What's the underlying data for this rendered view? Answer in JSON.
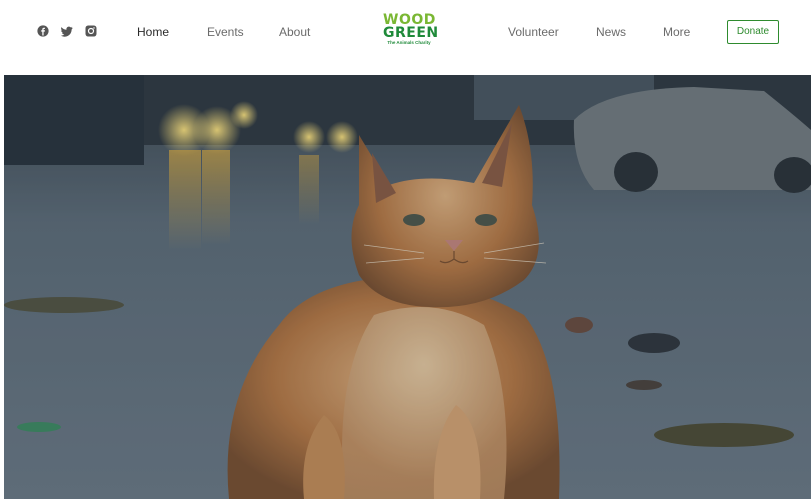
{
  "social": {
    "facebook_icon": "facebook-icon",
    "twitter_icon": "twitter-icon",
    "instagram_icon": "instagram-icon"
  },
  "nav": {
    "left": [
      {
        "label": "Home",
        "active": true
      },
      {
        "label": "Events",
        "active": false
      },
      {
        "label": "About",
        "active": false
      }
    ],
    "right": [
      {
        "label": "Volunteer",
        "active": false
      },
      {
        "label": "News",
        "active": false
      },
      {
        "label": "More",
        "active": false
      }
    ]
  },
  "logo": {
    "line1": "WOOD",
    "line2": "GREEN",
    "tagline": "The Animals Charity"
  },
  "donate": {
    "label": "Donate"
  },
  "colors": {
    "brand_green": "#2e8b2e",
    "logo_light_green": "#7ab733",
    "logo_dark_green": "#1f8a3a",
    "nav_text": "#6b6b6b"
  }
}
